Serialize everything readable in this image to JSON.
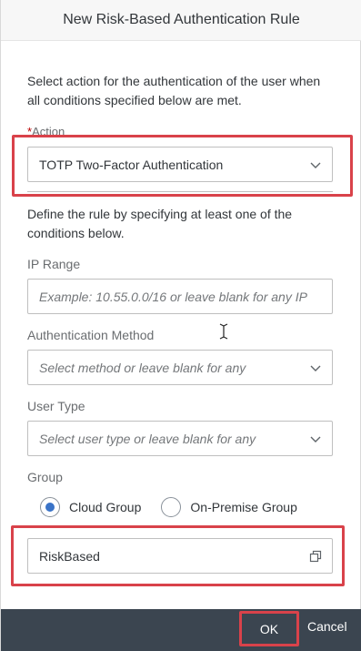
{
  "dialog": {
    "title": "New Risk-Based Authentication Rule"
  },
  "intro_text": "Select action for the authentication of the user when all conditions specified below are met.",
  "action": {
    "required_marker": "*",
    "label": "Action",
    "selected_value": "TOTP Two-Factor Authentication",
    "icon": "chevron-down-icon"
  },
  "conditions_text": "Define the rule by specifying at least one of the conditions below.",
  "ip_range": {
    "label": "IP Range",
    "placeholder": "Example: 10.55.0.0/16 or leave blank for any IP"
  },
  "auth_method": {
    "label": "Authentication Method",
    "placeholder": "Select method or leave blank for any",
    "icon": "chevron-down-icon"
  },
  "user_type": {
    "label": "User Type",
    "placeholder": "Select user type or leave blank for any",
    "icon": "chevron-down-icon"
  },
  "group": {
    "label": "Group",
    "options": [
      {
        "label": "Cloud Group",
        "selected": true
      },
      {
        "label": "On-Premise Group",
        "selected": false
      }
    ],
    "value": "RiskBased",
    "icon": "value-help-icon"
  },
  "footer": {
    "ok_label": "OK",
    "cancel_label": "Cancel"
  },
  "colors": {
    "highlight": "#d9424a",
    "footer_bg": "#3b4550",
    "radio_selected": "#3a73c7"
  }
}
